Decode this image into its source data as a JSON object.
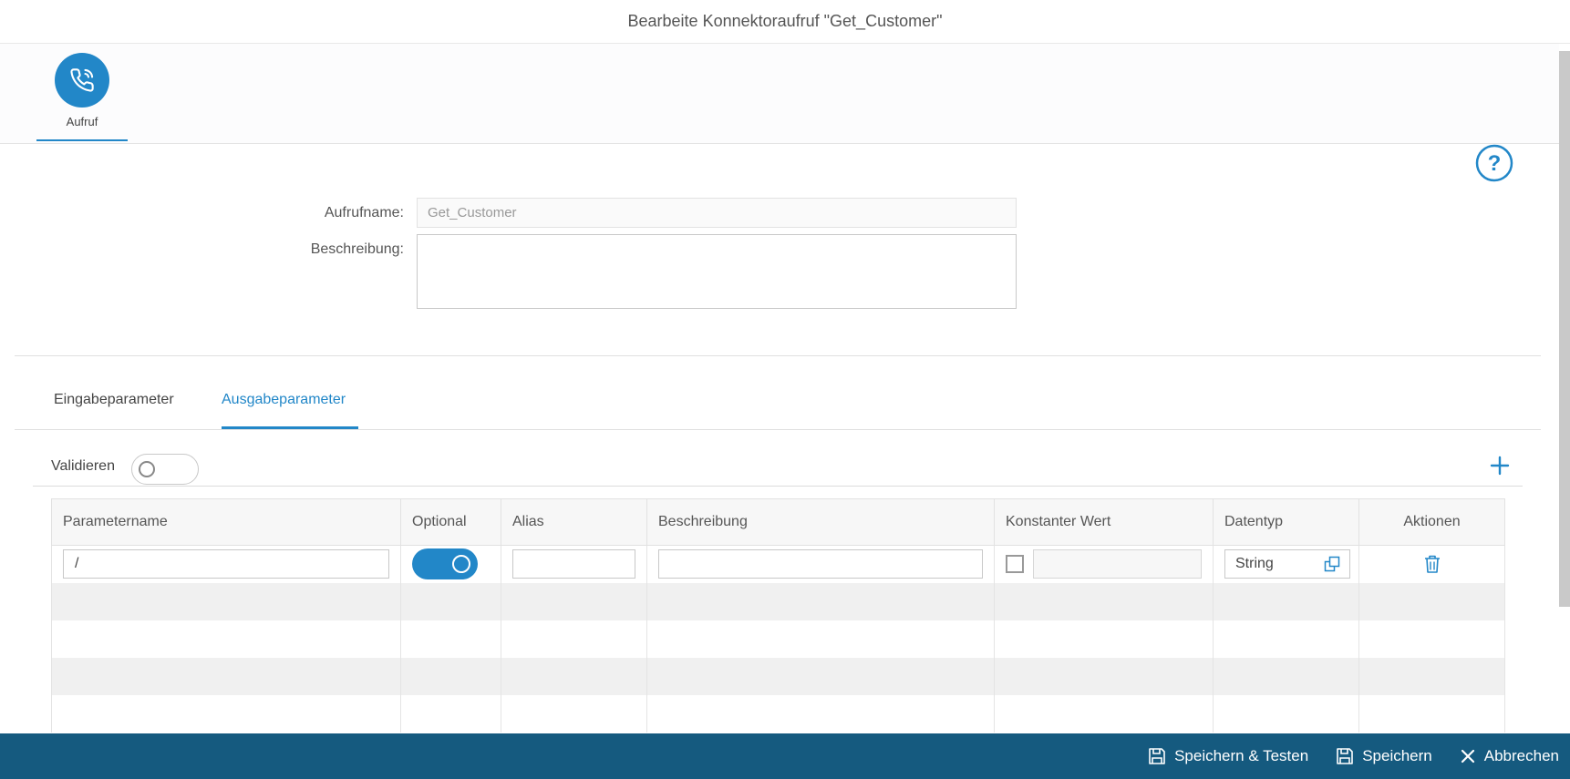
{
  "window": {
    "title": "Bearbeite Konnektoraufruf \"Get_Customer\""
  },
  "steps": [
    {
      "label": "Aufruf",
      "icon": "phone-icon",
      "active": true
    }
  ],
  "help": {
    "icon": "help-icon"
  },
  "form": {
    "name_label": "Aufrufname:",
    "name_value": "Get_Customer",
    "description_label": "Beschreibung:",
    "description_value": ""
  },
  "tabs": [
    {
      "label": "Eingabeparameter",
      "active": false
    },
    {
      "label": "Ausgabeparameter",
      "active": true
    }
  ],
  "validate": {
    "label": "Validieren",
    "enabled": false
  },
  "add_icon": "plus-icon",
  "table": {
    "headers": [
      "Parametername",
      "Optional",
      "Alias",
      "Beschreibung",
      "Konstanter Wert",
      "Datentyp",
      "Aktionen"
    ],
    "rows": [
      {
        "parametername": "/",
        "optional": true,
        "alias": "",
        "beschreibung": "",
        "konstant_checked": false,
        "konstant_value": "",
        "datentyp": "String"
      }
    ]
  },
  "footer": {
    "save_test_label": "Speichern & Testen",
    "save_label": "Speichern",
    "cancel_label": "Abbrechen"
  },
  "colors": {
    "accent": "#2287c8",
    "footer_bg": "#155a7f"
  }
}
